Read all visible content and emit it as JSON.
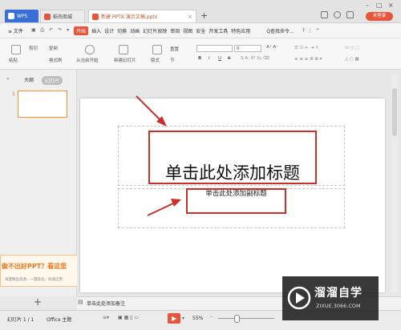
{
  "titlebar": {
    "wps_tab": "WPS",
    "store_tab": "稻壳商城",
    "doc_tab": "新建 PPTX 演示文稿.pptx",
    "login": "未登录"
  },
  "menubar": {
    "file": "≡ 文件",
    "items": [
      "开始",
      "插入",
      "设计",
      "切换",
      "动画",
      "幻灯片放映",
      "审阅",
      "视图",
      "安全",
      "开发工具",
      "特色应用"
    ],
    "search": "Q查找命令..."
  },
  "ribbon": {
    "paste": "粘贴",
    "cut": "剪切",
    "copy": "复制",
    "format_painter": "格式刷",
    "from_current": "从当前开始",
    "new_slide": "新建幻灯片",
    "layout": "版式",
    "section": "节",
    "reset": "重置",
    "font_size": "0",
    "bold": "B",
    "italic": "I",
    "underline": "U",
    "strike": "S"
  },
  "left_panel": {
    "outline_tab": "大纲",
    "slides_tab": "幻灯片",
    "slide_number": "1",
    "promo_title": "做不出好PPT？看这里",
    "promo_sub": "海量精品资源、一键美化、快速应用",
    "add": "+"
  },
  "slide": {
    "title": "单击此处添加标题",
    "subtitle": "单击此处添加副标题"
  },
  "notes": {
    "text": "单击此处添加备注"
  },
  "status": {
    "slide_count": "幻灯片 1 / 1",
    "theme": "Office 主题",
    "zoom": "55%"
  },
  "watermark": {
    "title": "溜溜自学",
    "url": "ZIXUE.3066.COM"
  },
  "colors": {
    "accent": "#e8553c",
    "annotation": "#c9302c"
  }
}
